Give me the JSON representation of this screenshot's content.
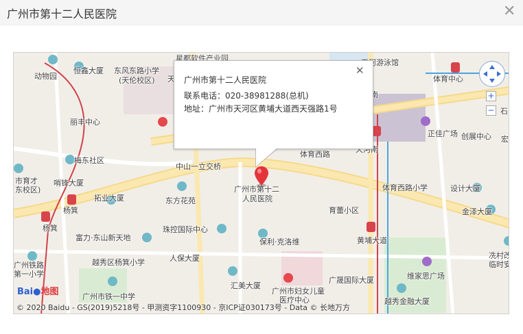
{
  "dialog": {
    "title": "广州市第十二人民医院",
    "close_glyph": "✕"
  },
  "popup": {
    "close_glyph": "✕",
    "name": "广州市第十二人民医院",
    "phone": "联系电话：020-38981288(总机)",
    "address": "地址：广州市天河区黄埔大道西天强路1号"
  },
  "marker": {
    "label_line1": "广州市第十二",
    "label_line2": "人民医院"
  },
  "controls": {
    "zoom_in": "+",
    "zoom_out": "−"
  },
  "logo": {
    "brand": "Bai",
    "brand_suffix": "du",
    "map_text": "地图"
  },
  "copyright": "© 2020 Baidu - GS(2019)5218号 - 甲测资字1100930 - 京ICP证030173号 - Data © 长地万方",
  "map_labels": {
    "l1": "星都软件产业园",
    "l2": "动物园",
    "l3": "恒鑫大厦",
    "l4": "东风东路小学",
    "l5": "(天伦校区)",
    "l6": "天",
    "l7": "海",
    "l8": "南",
    "l9": "丽丰中心",
    "l10": "梅东社区",
    "l11": "中山一立交桥",
    "l12": "体育西路",
    "l13": "天河南",
    "l14": "正佳广场",
    "l15": "创展中心",
    "l16": "宏",
    "l17": "体育中心",
    "l18": "石",
    "l19": "市育才",
    "l20": "东校区)",
    "l21": "哨锋大厦",
    "l22": "杨箕",
    "l23": "拓业大厦",
    "l24": "东方花苑",
    "l25": "体育西路小学",
    "l26": "设计大厦",
    "l27": "育蕾小区",
    "l28": "金泽大厦",
    "l29": "杨箕",
    "l30": "珠控国际中心",
    "l31": "富力·东山新天地",
    "l32": "保利·克洛维",
    "l33": "黄埔大道",
    "l34": "冼村改",
    "l35": "临时安",
    "l36": "广州铁路",
    "l37": "第一小学",
    "l38": "越秀区杨箕小学",
    "l39": "人保大厦",
    "l40": "汇美大厦",
    "l41": "广晟国际大厦",
    "l42": "维家思广场",
    "l43": "广州市铁一中学",
    "l44": "广州市妇女儿童",
    "l45": "医疗中心",
    "l46": "越秀金融大厦",
    "l47": "天河游泳馆"
  }
}
